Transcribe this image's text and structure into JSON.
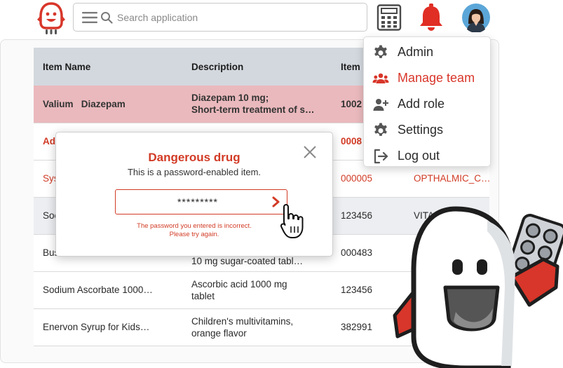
{
  "header": {
    "search_placeholder": "Search application"
  },
  "icons": {
    "logo": "mascot-logo-icon",
    "menu": "hamburger-icon",
    "search": "search-icon",
    "calculator": "calculator-icon",
    "notifications": "bell-icon",
    "profile": "avatar"
  },
  "colors": {
    "accent": "#d23b26",
    "header_row": "#d3d8de",
    "danger_row": "#eab9bd",
    "grey_row": "#eceef1"
  },
  "table": {
    "columns": [
      "Item Name",
      "Description",
      "Item",
      ""
    ],
    "rows": [
      {
        "name": "Valium   Diazepam",
        "description": "Diazepam 10 mg;\nShort-term treatment of s…",
        "item": "1002",
        "extra": ""
      },
      {
        "name": "Ad",
        "description": "",
        "item": "0008",
        "extra": ""
      },
      {
        "name": "Sys",
        "description": "",
        "item": "000005",
        "extra": "OPTHALMIC_C…"
      },
      {
        "name": "Soc",
        "description": "",
        "item": "123456",
        "extra": "VITAMINS A…"
      },
      {
        "name": "Bus",
        "description": "10 mg sugar-coated tabl…",
        "item": "000483",
        "extra": ""
      },
      {
        "name": "Sodium Ascorbate 1000…",
        "description": "Ascorbic acid 1000 mg\ntablet",
        "item": "123456",
        "extra": ""
      },
      {
        "name": "Enervon Syrup for Kids…",
        "description": "Children's multivitamins,\norange flavor",
        "item": "382991",
        "extra": ""
      }
    ]
  },
  "menu": {
    "items": [
      {
        "label": "Admin",
        "icon": "gear-icon"
      },
      {
        "label": "Manage team",
        "icon": "team-icon",
        "active": true
      },
      {
        "label": "Add role",
        "icon": "add-user-icon"
      },
      {
        "label": "Settings",
        "icon": "gear-icon"
      },
      {
        "label": "Log out",
        "icon": "logout-icon"
      }
    ]
  },
  "modal": {
    "title": "Dangerous drug",
    "subtitle": "This is a password-enabled item.",
    "password_value": "*********",
    "error_line1": "The password you entered is incorrect.",
    "error_line2": "Please try again."
  }
}
